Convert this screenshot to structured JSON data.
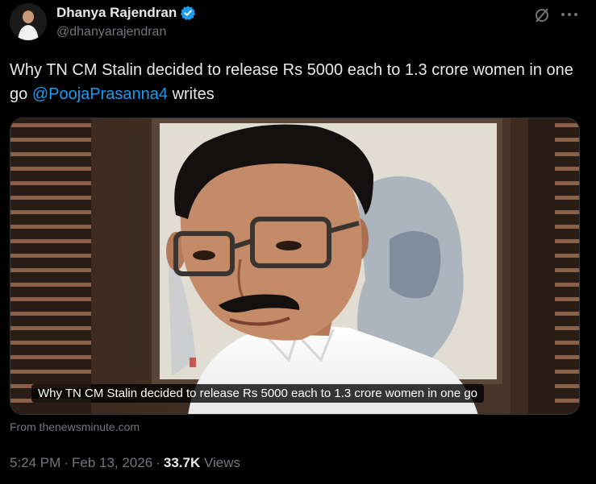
{
  "author": {
    "display_name": "Dhanya Rajendran",
    "handle": "@dhanyarajendran",
    "verified": true
  },
  "icons": {
    "avatar": "avatar",
    "verified": "verified-badge-icon",
    "grok": "grok-icon",
    "more": "more-options-icon"
  },
  "tweet": {
    "text_before": "Why TN CM Stalin decided to release Rs 5000 each to 1.3 crore women in one go ",
    "mention": "@PoojaPrasanna4",
    "text_after": " writes"
  },
  "card": {
    "caption": "Why TN CM Stalin decided to release Rs 5000 each to 1.3 crore women in one go",
    "source": "From thenewsminute.com"
  },
  "meta": {
    "time": "5:24 PM",
    "separator": "·",
    "date": "Feb 13, 2026",
    "views_count": "33.7K",
    "views_label": "Views"
  },
  "colors": {
    "background": "#000000",
    "text": "#e7e9ea",
    "muted": "#71767b",
    "link": "#1d9bf0",
    "verified": "#1d9bf0"
  }
}
